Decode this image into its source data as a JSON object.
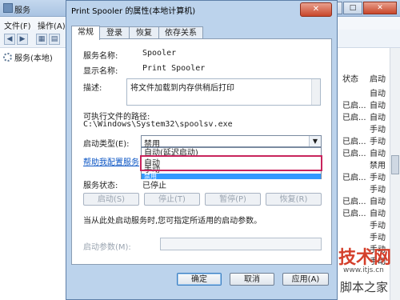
{
  "services_window": {
    "title": "服务",
    "menu": [
      "文件(F)",
      "操作(A)"
    ],
    "tree_root": "服务(本地)",
    "column_status": "状态",
    "column_start": "启动",
    "rows": [
      {
        "status": "",
        "start": "自动"
      },
      {
        "status": "已启...",
        "start": "自动"
      },
      {
        "status": "已启...",
        "start": "自动"
      },
      {
        "status": "",
        "start": "手动"
      },
      {
        "status": "已启...",
        "start": "手动"
      },
      {
        "status": "已启...",
        "start": "自动"
      },
      {
        "status": "",
        "start": "禁用"
      },
      {
        "status": "已启...",
        "start": "手动"
      },
      {
        "status": "",
        "start": "手动"
      },
      {
        "status": "已启...",
        "start": "自动"
      },
      {
        "status": "已启...",
        "start": "自动"
      },
      {
        "status": "",
        "start": "手动"
      },
      {
        "status": "",
        "start": "手动"
      },
      {
        "status": "",
        "start": "手动"
      },
      {
        "status": "",
        "start": "手动"
      }
    ]
  },
  "dialog": {
    "title": "Print Spooler 的属性(本地计算机)",
    "close": "✕",
    "tabs": [
      "常规",
      "登录",
      "恢复",
      "依存关系"
    ],
    "service_name_label": "服务名称:",
    "service_name": "Spooler",
    "display_name_label": "显示名称:",
    "display_name": "Print Spooler",
    "description_label": "描述:",
    "description": "将文件加载到内存供稍后打印",
    "exe_path_label": "可执行文件的路径:",
    "exe_path": "C:\\Windows\\System32\\spoolsv.exe",
    "startup_type_label": "启动类型(E):",
    "startup_type_value": "禁用",
    "startup_options": [
      "自动(延迟启动)",
      "自动",
      "手动",
      "禁用"
    ],
    "highlighted_option": "禁用",
    "help_link": "帮助我配置服务",
    "service_status_label": "服务状态:",
    "service_status": "已停止",
    "buttons": {
      "start": "启动(S)",
      "stop": "停止(T)",
      "pause": "暂停(P)",
      "resume": "恢复(R)"
    },
    "hint": "当从此处启动服务时,您可指定所适用的启动参数。",
    "start_params_label": "启动参数(M):",
    "ok": "确定",
    "cancel": "取消",
    "apply": "应用(A)"
  },
  "watermark": {
    "line1": "技术网",
    "line2": "www.itjs.cn",
    "line3": "脚本之家"
  },
  "colors": {
    "highlight": "#3399ff",
    "annotation_box": "#c8245c",
    "link": "#0b55c4"
  }
}
